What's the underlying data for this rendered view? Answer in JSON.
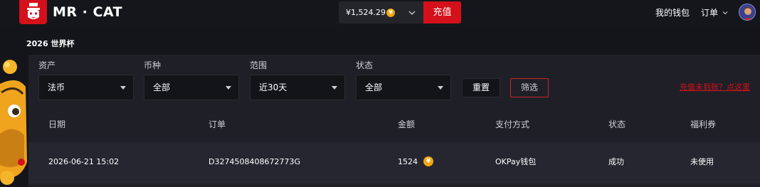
{
  "header": {
    "brand": "MR · CAT",
    "balance": "¥1,524.29",
    "balance_currency_icon": "yuan-coin-icon",
    "recharge_label": "充值",
    "nav_wallet": "我的钱包",
    "nav_orders": "订单",
    "accent_color": "#d4101a",
    "coin_color": "#f2a60c",
    "coin_glyph": "¥"
  },
  "page": {
    "title": "2026 世界杯"
  },
  "filters": {
    "asset": {
      "label": "资产",
      "value": "法币"
    },
    "currency": {
      "label": "币种",
      "value": "全部"
    },
    "range": {
      "label": "范围",
      "value": "近30天"
    },
    "status": {
      "label": "状态",
      "value": "全部"
    },
    "reset_label": "重置",
    "filter_label": "筛选",
    "help_link": "充值未到账？点这里"
  },
  "table": {
    "columns": [
      "日期",
      "订单",
      "金额",
      "支付方式",
      "状态",
      "福利券"
    ],
    "rows": [
      {
        "date": "2026-06-21 15:02",
        "order_id": "D3274508408672773G",
        "amount": "1524",
        "payment": "OKPay钱包",
        "status": "成功",
        "coupon": "未使用"
      }
    ]
  }
}
